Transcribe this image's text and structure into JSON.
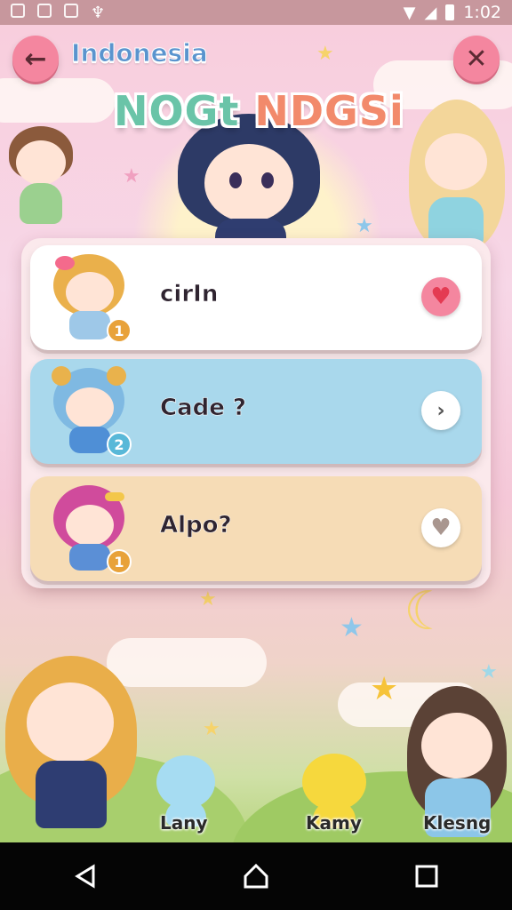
{
  "status_bar": {
    "time": "1:02",
    "icons": [
      "notification-icon",
      "image-icon",
      "media-icon",
      "trophy-icon",
      "wifi-icon",
      "signal-icon",
      "battery-icon"
    ]
  },
  "header": {
    "region": "Indonesia",
    "logo_part1": "NOGt ",
    "logo_part2": "NDGSi",
    "back_icon": "arrow-left-icon",
    "close_icon": "close-icon"
  },
  "entries": [
    {
      "name": "cirIn",
      "rank": "1",
      "rank_color": "#e8a23a",
      "action_icon": "heart-filled-icon",
      "card_color": "#ffffff"
    },
    {
      "name": "Cade ?",
      "rank": "2",
      "rank_color": "#59b8d8",
      "action_icon": "chevron-right-icon",
      "card_color": "#a9d8ec"
    },
    {
      "name": "Alpo?",
      "rank": "1",
      "rank_color": "#e8a23a",
      "action_icon": "heart-outline-icon",
      "card_color": "#f6dcb6"
    }
  ],
  "pets": [
    {
      "label": "Lany"
    },
    {
      "label": "Kamy"
    },
    {
      "label": "Klesng"
    }
  ],
  "colors": {
    "accent_pink": "#f4869f",
    "heart_red": "#e94e60",
    "status_bar": "#c7979d"
  }
}
